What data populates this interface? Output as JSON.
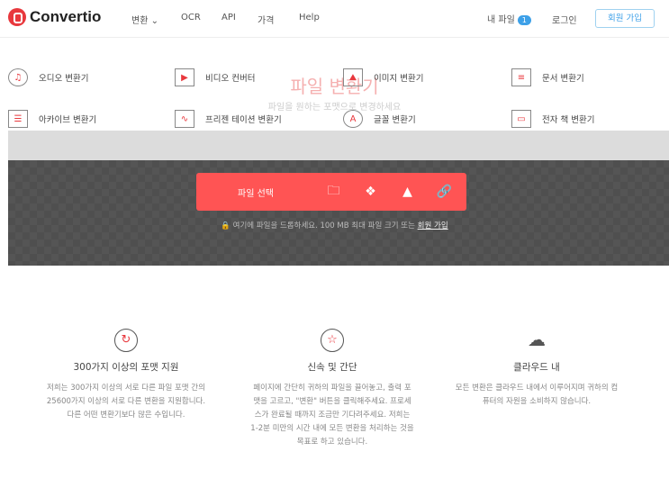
{
  "header": {
    "logo": "Convertio",
    "nav": [
      "변환",
      "OCR",
      "API",
      "가격",
      "Help"
    ],
    "my_files": "내 파일",
    "my_files_count": "1",
    "login": "로그인",
    "signup": "회원 가입"
  },
  "hero": {
    "title": "파일 변환기",
    "subtitle": "파일을 원하는 포맷으로 변경하세요"
  },
  "menu": [
    {
      "label": "오디오 변환기",
      "icon": "♫"
    },
    {
      "label": "비디오 컨버터",
      "icon": "▶"
    },
    {
      "label": "이미지 변환기",
      "icon": "⛰"
    },
    {
      "label": "문서 변환기",
      "icon": "≡"
    },
    {
      "label": "아카이브 변환기",
      "icon": "☰"
    },
    {
      "label": "프리젠 테이션 변환기",
      "icon": "∿"
    },
    {
      "label": "글꼴 변환기",
      "icon": "A"
    },
    {
      "label": "전자 책 변환기",
      "icon": "▭"
    }
  ],
  "upload": {
    "choose": "파일 선택",
    "drop_text": "여기에 파일을 드롭하세요. 100 MB 최대 파일 크기 또는",
    "signup_link": "회원 가입"
  },
  "features": [
    {
      "title": "300가지 이상의 포맷 지원",
      "text": "저희는 300가지 이상의 서로 다른 파일 포맷 간의 25600가지 이상의 서로 다른 변환을 지원합니다. 다른 어떤 변환기보다 많은 수입니다."
    },
    {
      "title": "신속 및 간단",
      "text": "페이지에 간단히 귀하의 파일을 끌어놓고, 출력 포맷을 고르고, \"변환\" 버튼을 클릭해주세요. 프로세스가 완료될 때까지 조금만 기다려주세요. 저희는 1-2분 미만의 시간 내에 모든 변환을 처리하는 것을 목표로 하고 있습니다."
    },
    {
      "title": "클라우드 내",
      "text": "모든 변환은 클라우드 내에서 이루어지며 귀하의 컴퓨터의 자원을 소비하지 않습니다."
    }
  ],
  "colors": {
    "brand": "#ff5454",
    "accent": "#3da0e8"
  }
}
